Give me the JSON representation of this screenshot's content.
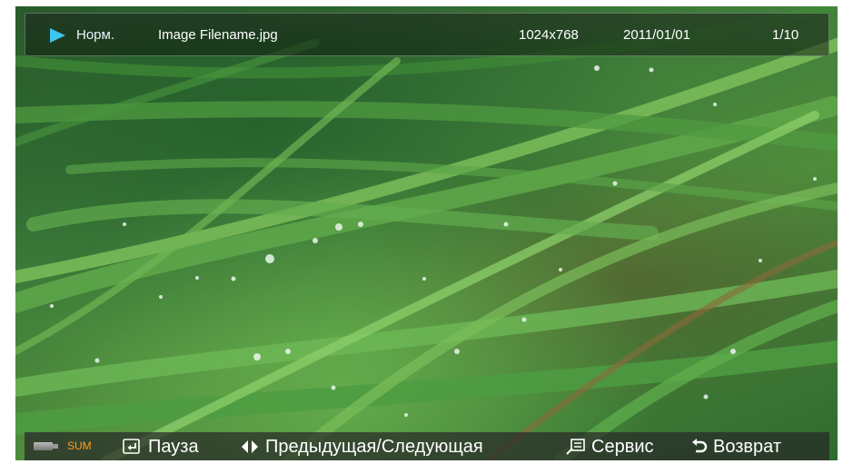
{
  "info_bar": {
    "mode_label": "Норм.",
    "filename": "Image Filename.jpg",
    "resolution": "1024x768",
    "date": "2011/01/01",
    "counter": "1/10",
    "play_icon": "play-triangle-icon",
    "accent_color": "#3fc4ef"
  },
  "control_bar": {
    "device_icon": "usb-device-icon",
    "device_label": "SUM",
    "device_label_color": "#ff9e1f",
    "pause_label": "Пауза",
    "prev_next_label": "Предыдущая/Следующая",
    "tools_label": "Сервис",
    "return_label": "Возврат"
  }
}
